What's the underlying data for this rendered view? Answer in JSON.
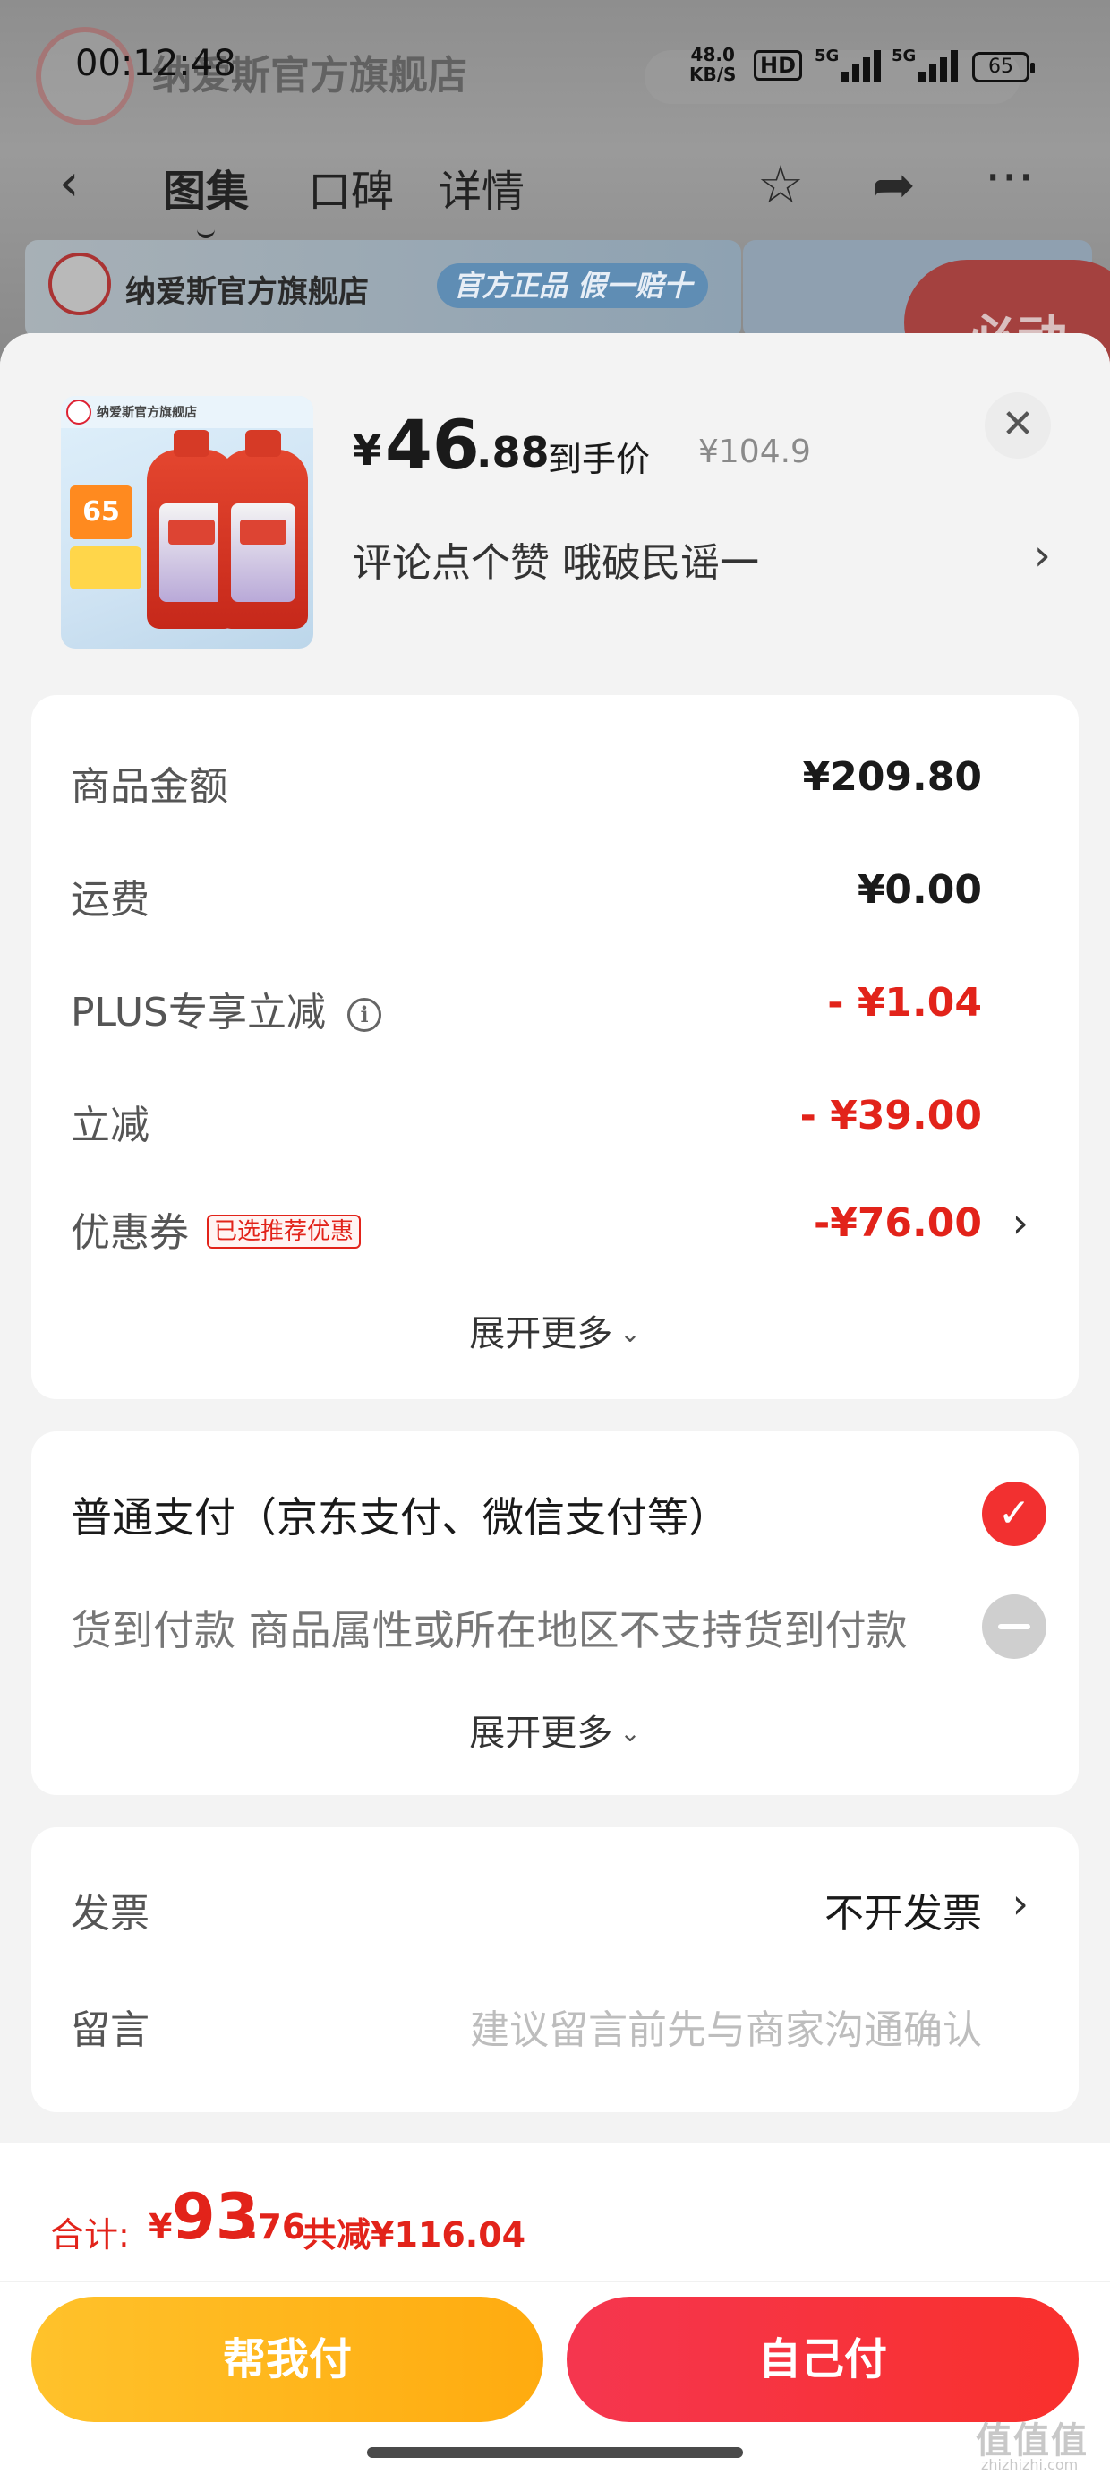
{
  "status_bar": {
    "time": "00:12:48",
    "net_speed": "48.0",
    "net_unit": "KB/S",
    "hd": "HD",
    "sig1": "5G",
    "sig2": "5G",
    "battery": "65"
  },
  "background_page": {
    "store_title": "纳爱斯官方旗舰店",
    "tabs": [
      {
        "label": "图集",
        "active": true
      },
      {
        "label": "口碑",
        "active": false
      },
      {
        "label": "详情",
        "active": false
      }
    ],
    "banner_store": "纳爱斯官方旗舰店",
    "banner_tag": "官方正品 假一赔十",
    "banner_red": "必动",
    "icons": [
      "back-icon",
      "star-icon",
      "share-icon",
      "more-icon"
    ]
  },
  "product": {
    "thumb_store": "纳爱斯官方旗舰店",
    "thumb_badge": "65",
    "price_currency": "¥",
    "price_int": "46",
    "price_dec": ".88",
    "price_label": "到手价",
    "original_price": "¥104.9",
    "promo_text": "评论点个赞  哦破民谣一",
    "close_glyph": "✕",
    "chevron": "›"
  },
  "summary": {
    "rows": [
      {
        "label": "商品金额",
        "value": "¥209.80",
        "color": "#1a1a1a"
      },
      {
        "label": "运费",
        "value": "¥0.00",
        "color": "#1a1a1a"
      },
      {
        "label": "PLUS专享立减",
        "value": "- ¥1.04",
        "color": "#e2231a"
      },
      {
        "label": "立减",
        "value": "- ¥39.00",
        "color": "#e2231a"
      },
      {
        "label": "优惠券",
        "tag": "已选推荐优惠",
        "value": "-¥76.00",
        "color": "#e2231a"
      }
    ],
    "info_glyph": "i",
    "expand_label": "展开更多",
    "caret": "⌄"
  },
  "payment": {
    "options": [
      {
        "label": "普通支付（京东支付、微信支付等）",
        "selected": true
      },
      {
        "label": "货到付款 商品属性或所在地区不支持货到付款",
        "selected": false
      }
    ],
    "check_glyph": "✓",
    "expand_label": "展开更多"
  },
  "extras": {
    "invoice_label": "发票",
    "invoice_value": "不开发票",
    "remark_label": "留言",
    "remark_placeholder": "建议留言前先与商家沟通确认"
  },
  "footer": {
    "total_label": "合计:",
    "total_currency": "¥",
    "total_int": "93",
    "total_dec": ".76",
    "total_saved": "共减¥116.04",
    "help_pay": "帮我付",
    "self_pay": "自己付",
    "watermark": "值值值",
    "watermark_sub": "zhizhizhi.com"
  },
  "colors": {
    "accent_red": "#e2231a",
    "help_btn": "#ffb31a",
    "self_btn": "#f7334a"
  }
}
